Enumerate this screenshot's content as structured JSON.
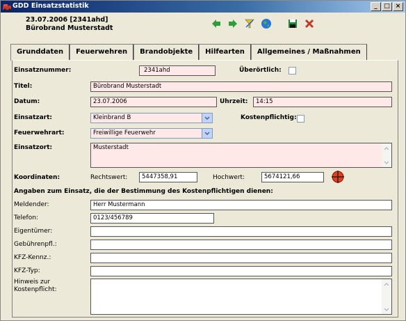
{
  "window": {
    "title": "GDD Einsatzstatistik",
    "controls": {
      "minimize": "_",
      "maximize": "□",
      "close": "×"
    }
  },
  "header": {
    "line1": "23.07.2006 [2341ahd]",
    "line2": "Bürobrand Musterstadt"
  },
  "toolbar": {
    "buttons": [
      "arrow-left-icon",
      "arrow-right-icon",
      "filter-icon",
      "globe-icon",
      "save-icon",
      "delete-icon"
    ]
  },
  "tabs": [
    "Grunddaten",
    "Feuerwehren",
    "Brandobjekte",
    "Hilfearten",
    "Allgemeines / Maßnahmen"
  ],
  "form": {
    "einsatznummer_label": "Einsatznummer:",
    "einsatznummer": "2341ahd",
    "ueberoertlich_label": "Überörtlich:",
    "titel_label": "Titel:",
    "titel": "Bürobrand Musterstadt",
    "datum_label": "Datum:",
    "datum": "23.07.2006",
    "uhrzeit_label": "Uhrzeit:",
    "uhrzeit": "14:15",
    "einsatzart_label": "Einsatzart:",
    "einsatzart": "Kleinbrand B",
    "kostenpflichtig_label": "Kostenpflichtig:",
    "feuerwehrart_label": "Feuerwehrart:",
    "feuerwehrart": "Freiwillige Feuerwehr",
    "einsatzort_label": "Einsatzort:",
    "einsatzort": "Musterstadt",
    "koordinaten_label": "Koordinaten:",
    "rechtswert_label": "Rechtswert:",
    "rechtswert": "5447358,91",
    "hochwert_label": "Hochwert:",
    "hochwert": "5674121,66",
    "section_title": "Angaben zum Einsatz, die der Bestimmung des Kostenpflichtigen dienen:",
    "meldender_label": "Meldender:",
    "meldender": "Herr Mustermann",
    "telefon_label": "Telefon:",
    "telefon": "0123/456789",
    "eigentuemer_label": "Eigentümer:",
    "gebuehrenpfl_label": "Gebührenpfl.:",
    "kfz_kennz_label": "KFZ-Kennz.:",
    "kfz_typ_label": "KFZ-Typ:",
    "hinweis_label1": "Hinweis zur",
    "hinweis_label2": "Kostenpflicht:"
  }
}
